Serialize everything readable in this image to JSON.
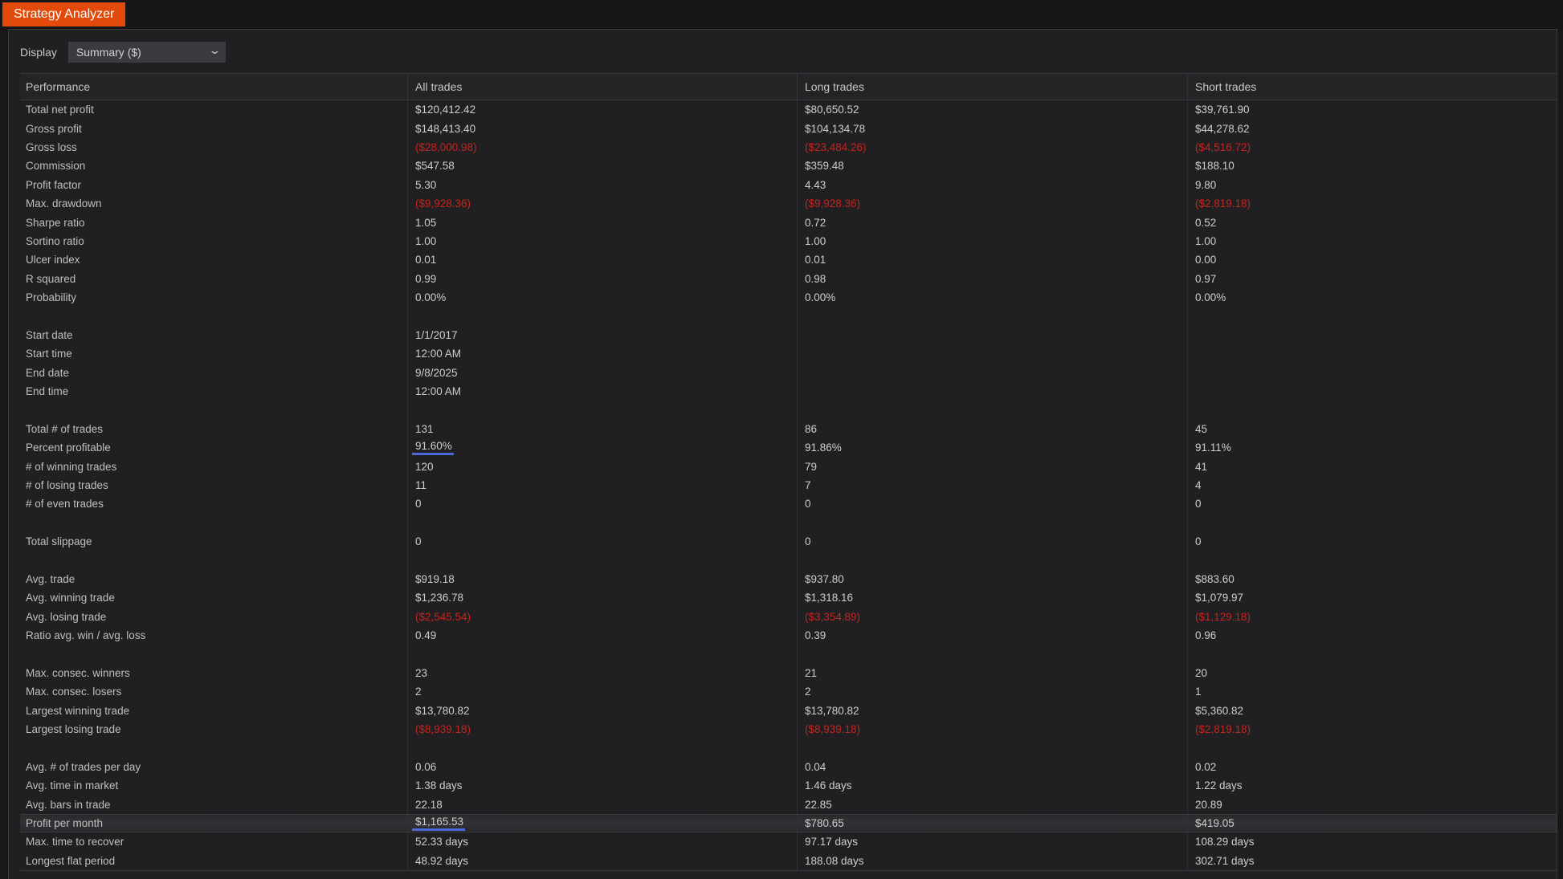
{
  "colors": {
    "accent_orange": "#e24a0c",
    "negative_red": "#c7231d",
    "underline_blue": "#4a6bd8",
    "panel_bg": "#202022",
    "page_bg": "#181818"
  },
  "tab": {
    "title": "Strategy Analyzer"
  },
  "toolbar": {
    "display_label": "Display",
    "display_value": "Summary ($)",
    "chevron_icon": "⌄"
  },
  "table": {
    "columns": [
      "Performance",
      "All trades",
      "Long trades",
      "Short trades"
    ],
    "rows": [
      {
        "label": "Total net profit",
        "values": [
          "$120,412.42",
          "$80,650.52",
          "$39,761.90"
        ]
      },
      {
        "label": "Gross profit",
        "values": [
          "$148,413.40",
          "$104,134.78",
          "$44,278.62"
        ]
      },
      {
        "label": "Gross loss",
        "values": [
          "($28,000.98)",
          "($23,484.26)",
          "($4,516.72)"
        ]
      },
      {
        "label": "Commission",
        "values": [
          "$547.58",
          "$359.48",
          "$188.10"
        ]
      },
      {
        "label": "Profit factor",
        "values": [
          "5.30",
          "4.43",
          "9.80"
        ]
      },
      {
        "label": "Max. drawdown",
        "values": [
          "($9,928.36)",
          "($9,928.36)",
          "($2,819.18)"
        ]
      },
      {
        "label": "Sharpe ratio",
        "values": [
          "1.05",
          "0.72",
          "0.52"
        ]
      },
      {
        "label": "Sortino ratio",
        "values": [
          "1.00",
          "1.00",
          "1.00"
        ]
      },
      {
        "label": "Ulcer index",
        "values": [
          "0.01",
          "0.01",
          "0.00"
        ]
      },
      {
        "label": "R squared",
        "values": [
          "0.99",
          "0.98",
          "0.97"
        ]
      },
      {
        "label": "Probability",
        "values": [
          "0.00%",
          "0.00%",
          "0.00%"
        ]
      },
      {
        "blank": true
      },
      {
        "label": "Start date",
        "values": [
          "1/1/2017",
          "",
          ""
        ]
      },
      {
        "label": "Start time",
        "values": [
          "12:00 AM",
          "",
          ""
        ]
      },
      {
        "label": "End date",
        "values": [
          "9/8/2025",
          "",
          ""
        ]
      },
      {
        "label": "End time",
        "values": [
          "12:00 AM",
          "",
          ""
        ]
      },
      {
        "blank": true
      },
      {
        "label": "Total # of trades",
        "values": [
          "131",
          "86",
          "45"
        ]
      },
      {
        "label": "Percent profitable",
        "values": [
          "91.60%",
          "91.86%",
          "91.11%"
        ],
        "underline_cols": [
          0
        ]
      },
      {
        "label": "# of winning trades",
        "values": [
          "120",
          "79",
          "41"
        ]
      },
      {
        "label": "# of losing trades",
        "values": [
          "11",
          "7",
          "4"
        ]
      },
      {
        "label": "# of even trades",
        "values": [
          "0",
          "0",
          "0"
        ]
      },
      {
        "blank": true
      },
      {
        "label": "Total slippage",
        "values": [
          "0",
          "0",
          "0"
        ]
      },
      {
        "blank": true
      },
      {
        "label": "Avg. trade",
        "values": [
          "$919.18",
          "$937.80",
          "$883.60"
        ]
      },
      {
        "label": "Avg. winning trade",
        "values": [
          "$1,236.78",
          "$1,318.16",
          "$1,079.97"
        ]
      },
      {
        "label": "Avg. losing trade",
        "values": [
          "($2,545.54)",
          "($3,354.89)",
          "($1,129.18)"
        ]
      },
      {
        "label": "Ratio avg. win / avg. loss",
        "values": [
          "0.49",
          "0.39",
          "0.96"
        ]
      },
      {
        "blank": true
      },
      {
        "label": "Max. consec. winners",
        "values": [
          "23",
          "21",
          "20"
        ]
      },
      {
        "label": "Max. consec. losers",
        "values": [
          "2",
          "2",
          "1"
        ]
      },
      {
        "label": "Largest winning trade",
        "values": [
          "$13,780.82",
          "$13,780.82",
          "$5,360.82"
        ]
      },
      {
        "label": "Largest losing trade",
        "values": [
          "($8,939.18)",
          "($8,939.18)",
          "($2,819.18)"
        ]
      },
      {
        "blank": true
      },
      {
        "label": "Avg. # of trades per day",
        "values": [
          "0.06",
          "0.04",
          "0.02"
        ]
      },
      {
        "label": "Avg. time in market",
        "values": [
          "1.38 days",
          "1.46 days",
          "1.22 days"
        ]
      },
      {
        "label": "Avg. bars in trade",
        "values": [
          "22.18",
          "22.85",
          "20.89"
        ]
      },
      {
        "label": "Profit per month",
        "values": [
          "$1,165.53",
          "$780.65",
          "$419.05"
        ],
        "underline_cols": [
          0
        ],
        "highlight": true
      },
      {
        "label": "Max. time to recover",
        "values": [
          "52.33 days",
          "97.17 days",
          "108.29 days"
        ]
      },
      {
        "label": "Longest flat period",
        "values": [
          "48.92 days",
          "188.08 days",
          "302.71 days"
        ]
      }
    ]
  }
}
